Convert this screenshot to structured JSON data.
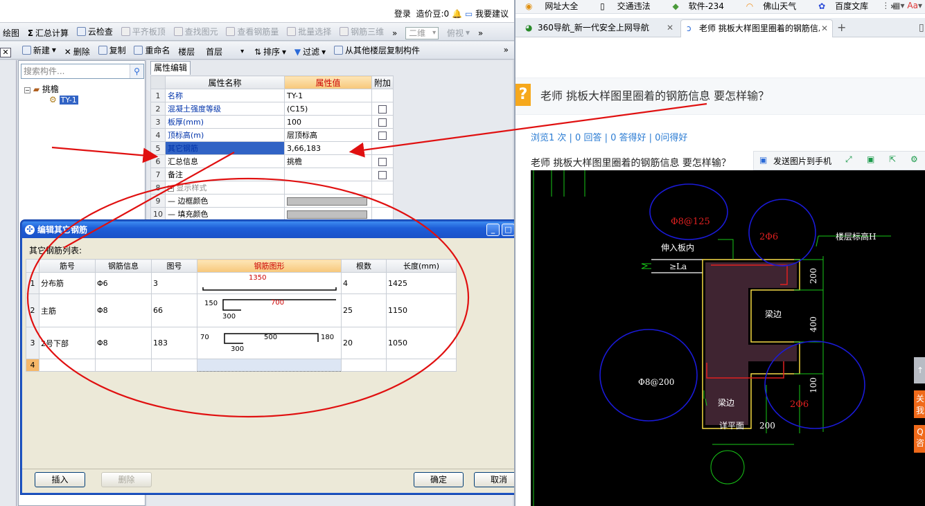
{
  "top": {
    "login": "登录",
    "price_beans": "造价豆:0",
    "suggest": "我要建议"
  },
  "toolbar1": {
    "items": [
      "绘图",
      "汇总计算",
      "云检查",
      "平齐板顶",
      "查找图元",
      "查看钢筋量",
      "批量选择",
      "钢筋三维"
    ],
    "more": "»",
    "view_2d": "二维",
    "view_top": "俯视",
    "more2": "»"
  },
  "toolbar2": {
    "new": "新建",
    "delete": "删除",
    "copy": "复制",
    "rename": "重命名",
    "floor_label": "楼层",
    "floor_value": "首层",
    "sort": "排序",
    "filter": "过滤",
    "copy_from": "从其他楼层复制构件",
    "more": "»"
  },
  "tree": {
    "search_placeholder": "搜索构件...",
    "root": "挑檐",
    "child": "TY-1"
  },
  "props": {
    "tab": "属性编辑",
    "col_name": "属性名称",
    "col_value": "属性值",
    "col_extra": "附加",
    "rows": [
      {
        "n": "1",
        "name": "名称",
        "value": "TY-1"
      },
      {
        "n": "2",
        "name": "混凝土强度等级",
        "value": "(C15)"
      },
      {
        "n": "3",
        "name": "板厚(mm)",
        "value": "100"
      },
      {
        "n": "4",
        "name": "顶标高(m)",
        "value": "层顶标高"
      },
      {
        "n": "5",
        "name": "其它钢筋",
        "value": "3,66,183"
      },
      {
        "n": "6",
        "name": "汇总信息",
        "value": "挑檐"
      },
      {
        "n": "7",
        "name": "备注",
        "value": ""
      },
      {
        "n": "8",
        "name": "显示样式",
        "value": ""
      },
      {
        "n": "9",
        "name": "边框颜色",
        "value": ""
      },
      {
        "n": "10",
        "name": "填充颜色",
        "value": ""
      }
    ]
  },
  "dialog": {
    "title": "编辑其它钢筋",
    "list_label": "其它钢筋列表:",
    "headers": [
      "筋号",
      "钢筋信息",
      "图号",
      "钢筋图形",
      "根数",
      "长度(mm)"
    ],
    "rows": [
      {
        "n": "1",
        "name": "分布筋",
        "info": "Φ6",
        "fig": "3",
        "count": "4",
        "length": "1425",
        "shape": {
          "a": "1350"
        }
      },
      {
        "n": "2",
        "name": "主筋",
        "info": "Φ8",
        "fig": "66",
        "count": "25",
        "length": "1150",
        "shape": {
          "a": "150",
          "b": "700",
          "c": "300"
        }
      },
      {
        "n": "3",
        "name": "2号下部",
        "info": "Φ8",
        "fig": "183",
        "count": "20",
        "length": "1050",
        "shape": {
          "a": "70",
          "b": "500",
          "c": "180",
          "d": "300"
        }
      },
      {
        "n": "4",
        "name": "",
        "info": "",
        "fig": "",
        "count": "",
        "length": ""
      }
    ],
    "insert": "插入",
    "delete": "删除",
    "ok": "确定",
    "cancel": "取消"
  },
  "browser": {
    "bookmarks": [
      "网址大全",
      "交通违法",
      "软件-234",
      "佛山天气",
      "百度文库",
      "»"
    ],
    "tab1": "360导航_新一代安全上网导航",
    "tab2": "老师 挑板大样图里圈着的钢筋信息",
    "question_title": "老师 挑板大样图里圈着的钢筋信息 要怎样输？",
    "stats": "浏览1 次 | 0 回答 | 0 答得好 | 0问得好",
    "desc": "老师 挑板大样图里圈着的钢筋信息 要怎样输？",
    "send_to_phone": "发送图片到手机",
    "side1": "关\n我",
    "side2": "Q\n咨",
    "side0": "↑"
  },
  "cad": {
    "t1": "Φ8@125",
    "t2": "伸入板内",
    "t3": "≥La",
    "t4": "2Φ6",
    "t5": "楼层标高H",
    "t6": "200",
    "t7": "400",
    "t8": "梁边",
    "t9": "100",
    "t10": "Φ8@200",
    "t11": "梁边",
    "t12": "2Φ6",
    "t13": "详平面",
    "t14": "200"
  },
  "colors": {
    "annotation_red": "#e01010",
    "selected_row": "#3163c5",
    "cad_blue": "#1a1ad8"
  }
}
